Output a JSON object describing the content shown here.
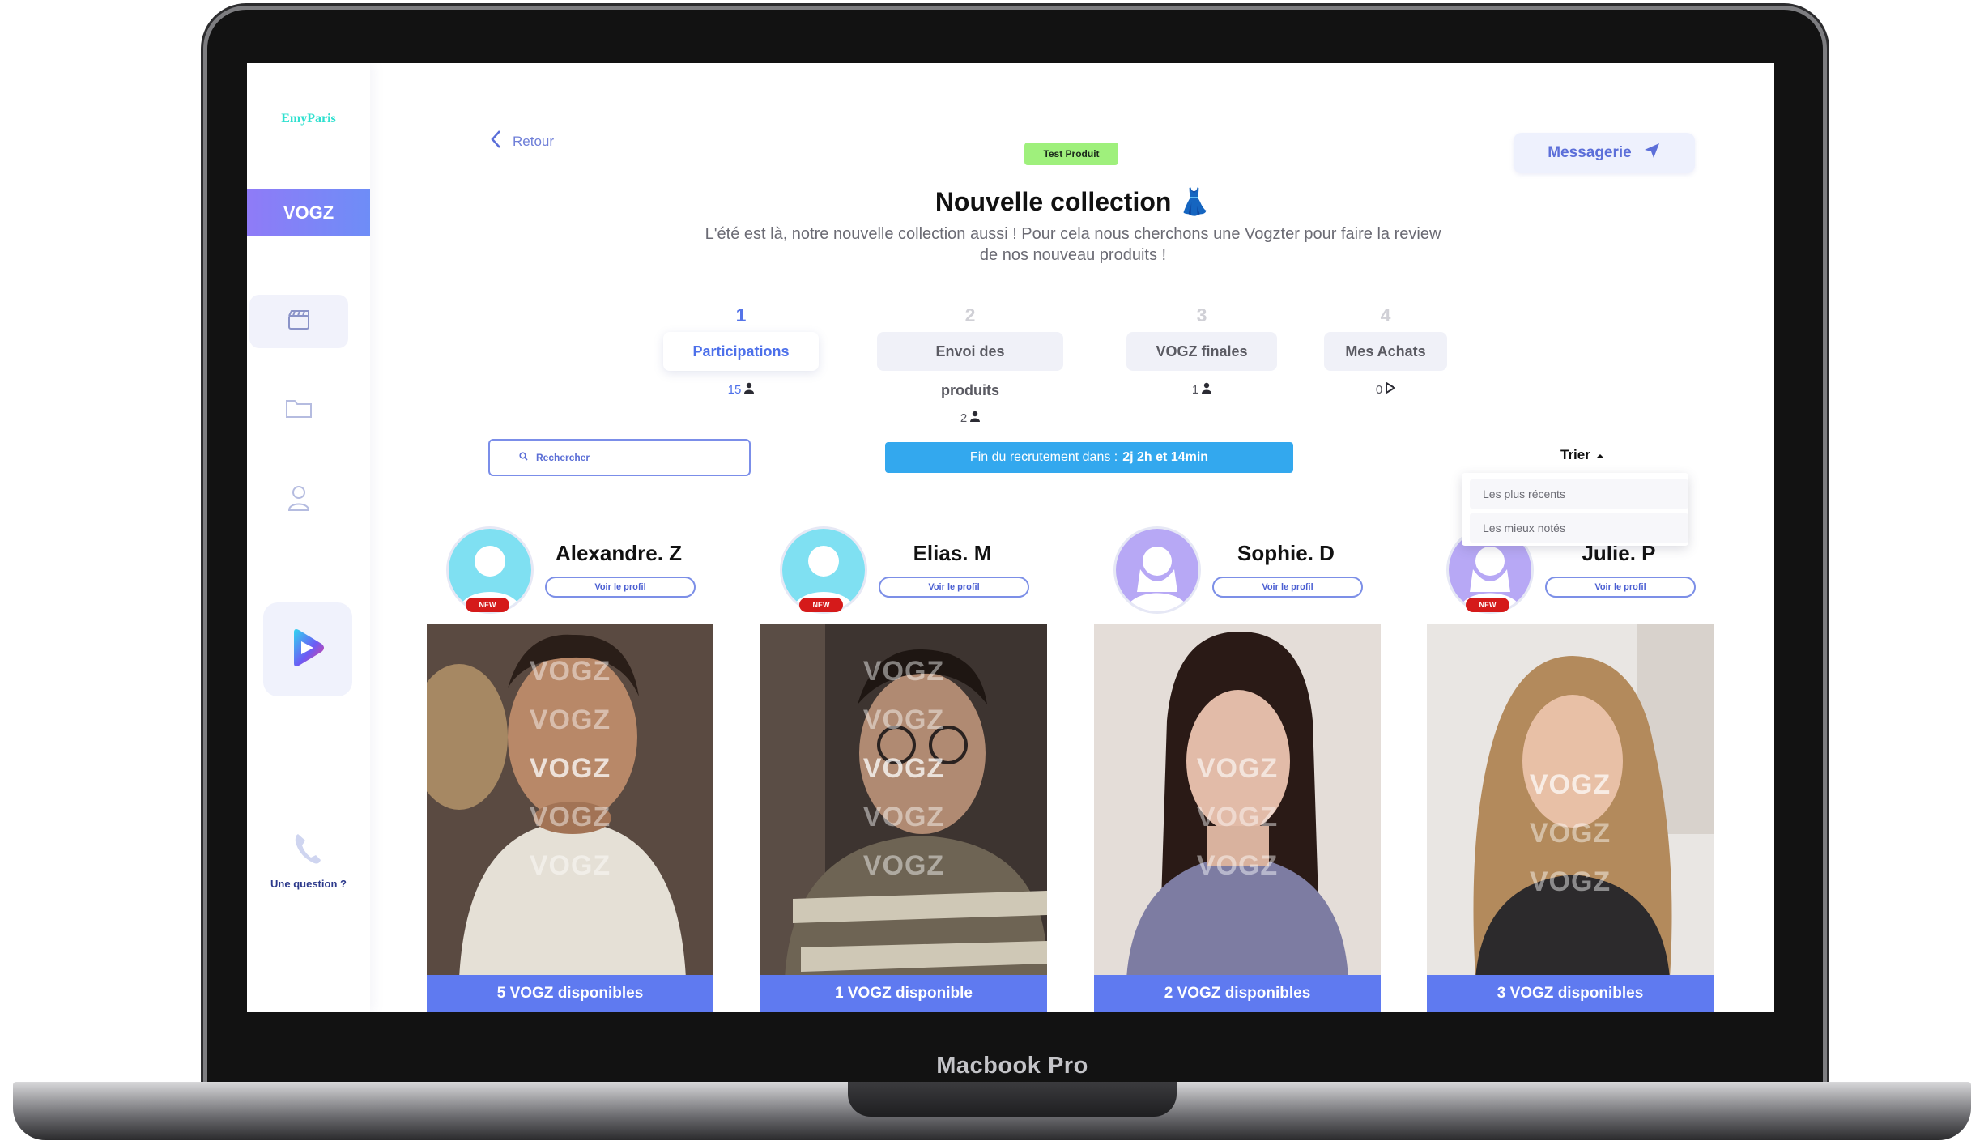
{
  "device": {
    "brand_label": "Macbook Pro"
  },
  "sidebar": {
    "logo": "EmyParis",
    "active_tab": "VOGZ",
    "nav_icons": [
      "clapperboard-icon",
      "folder-icon",
      "user-icon",
      "play-logo-icon"
    ],
    "help_label": "Une question ?"
  },
  "header": {
    "back_label": "Retour",
    "tag": "Test Produit",
    "title": "Nouvelle collection",
    "title_emoji": "👗",
    "subtitle": "L'été est là, notre nouvelle collection aussi ! Pour cela nous cherchons une Vogzter pour faire la review de nos nouveau produits !",
    "messaging_label": "Messagerie"
  },
  "steps": [
    {
      "number": "1",
      "label": "Participations",
      "count": "15",
      "count_icon": "user-icon",
      "active": true
    },
    {
      "number": "2",
      "label": "Envoi des produits",
      "count": "2",
      "count_icon": "user-icon",
      "active": false
    },
    {
      "number": "3",
      "label": "VOGZ finales",
      "count": "1",
      "count_icon": "user-icon",
      "active": false
    },
    {
      "number": "4",
      "label": "Mes Achats",
      "count": "0",
      "count_icon": "play-icon",
      "active": false
    }
  ],
  "search": {
    "placeholder": "Rechercher"
  },
  "recruitment": {
    "label": "Fin du recrutement dans :",
    "remaining": "2j 2h et 14min"
  },
  "sort": {
    "label": "Trier",
    "options": [
      "Les plus récents",
      "Les mieux notés"
    ]
  },
  "cards": [
    {
      "name": "Alexandre. Z",
      "profile_label": "Voir le profil",
      "badge": "NEW",
      "available": "5 VOGZ disponibles",
      "watermark": "VOGZ"
    },
    {
      "name": "Elias. M",
      "profile_label": "Voir le profil",
      "badge": "NEW",
      "available": "1 VOGZ disponible",
      "watermark": "VOGZ"
    },
    {
      "name": "Sophie. D",
      "profile_label": "Voir le profil",
      "badge": "",
      "available": "2 VOGZ disponibles",
      "watermark": "VOGZ"
    },
    {
      "name": "Julie. P",
      "profile_label": "Voir le profil",
      "badge": "NEW",
      "available": "3 VOGZ disponibles",
      "watermark": "VOGZ"
    }
  ],
  "colors": {
    "accent": "#5f7af0",
    "banner": "#33a8ee",
    "tag": "#9ff07c",
    "badge": "#d51a1a"
  }
}
